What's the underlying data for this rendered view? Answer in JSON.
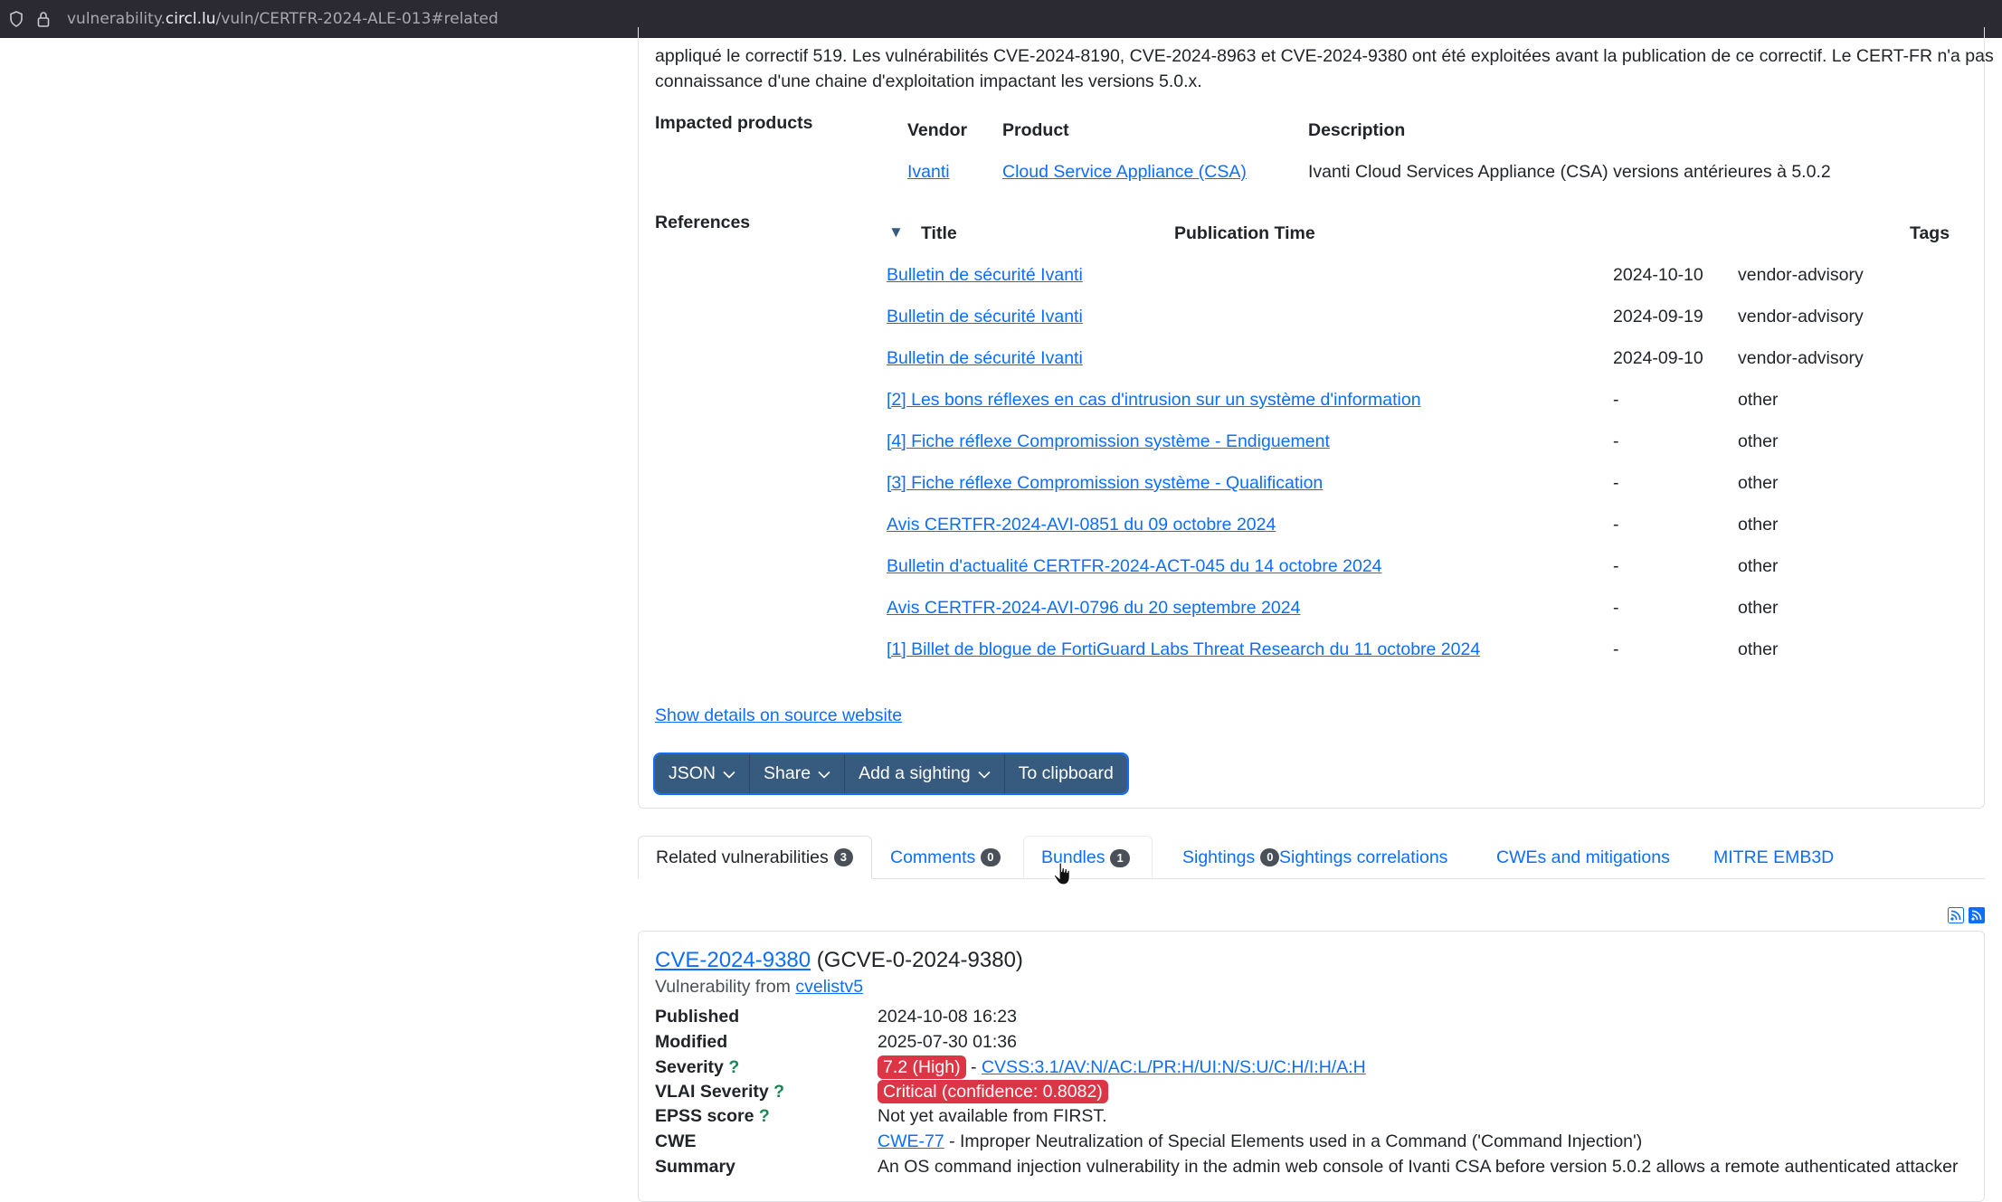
{
  "browser": {
    "url_prefix": "vulnerability.",
    "url_host": "circl.lu",
    "url_path": "/vuln/CERTFR-2024-ALE-013#related"
  },
  "description": {
    "line1": "appliqué le correctif 519. Les vulnérabilités CVE-2024-8190, CVE-2024-8963 et CVE-2024-9380 ont été exploitées avant la publication de ce correctif. Le CERT-FR n'a pas",
    "line2": "connaissance d'une chaine d'exploitation impactant les versions 5.0.x."
  },
  "impacted": {
    "label": "Impacted products",
    "headers": {
      "vendor": "Vendor",
      "product": "Product",
      "description": "Description"
    },
    "row": {
      "vendor": "Ivanti",
      "product": "Cloud Service Appliance (CSA)",
      "description": "Ivanti Cloud Services Appliance (CSA) versions antérieures à 5.0.2"
    }
  },
  "references": {
    "label": "References",
    "sort_glyph": "▼",
    "headers": {
      "title": "Title",
      "pubtime": "Publication Time",
      "tags": "Tags"
    },
    "rows": [
      {
        "title": "Bulletin de sécurité Ivanti",
        "date": "2024-10-10",
        "tag": "vendor-advisory"
      },
      {
        "title": "Bulletin de sécurité Ivanti",
        "date": "2024-09-19",
        "tag": "vendor-advisory"
      },
      {
        "title": "Bulletin de sécurité Ivanti",
        "date": "2024-09-10",
        "tag": "vendor-advisory"
      },
      {
        "title": "[2] Les bons réflexes en cas d'intrusion sur un système d'information",
        "date": "-",
        "tag": "other"
      },
      {
        "title": "[4] Fiche réflexe Compromission système - Endiguement",
        "date": "-",
        "tag": "other"
      },
      {
        "title": "[3] Fiche réflexe Compromission système - Qualification",
        "date": "-",
        "tag": "other"
      },
      {
        "title": "Avis CERTFR-2024-AVI-0851 du 09 octobre 2024",
        "date": "-",
        "tag": "other"
      },
      {
        "title": "Bulletin d'actualité CERTFR-2024-ACT-045 du 14 octobre 2024",
        "date": "-",
        "tag": "other"
      },
      {
        "title": "Avis CERTFR-2024-AVI-0796 du 20 septembre 2024",
        "date": "-",
        "tag": "other"
      },
      {
        "title": "[1] Billet de blogue de FortiGuard Labs Threat Research du 11 octobre 2024",
        "date": "-",
        "tag": "other"
      }
    ]
  },
  "source_link": "Show details on source website",
  "actions": {
    "json": "JSON",
    "share": "Share",
    "add_sighting": "Add a sighting",
    "clipboard": "To clipboard"
  },
  "tabs": [
    {
      "label": "Related vulnerabilities",
      "count": "3"
    },
    {
      "label": "Comments",
      "count": "0"
    },
    {
      "label": "Bundles",
      "count": "1"
    },
    {
      "label": "Sightings",
      "count": "0"
    },
    {
      "label": "Sightings correlations",
      "count": ""
    },
    {
      "label": "CWEs and mitigations",
      "count": ""
    },
    {
      "label": "MITRE EMB3D",
      "count": ""
    }
  ],
  "vuln": {
    "id": "CVE-2024-9380",
    "gcve": "(GCVE-0-2024-9380)",
    "from_label": "Vulnerability from",
    "from_source": "cvelistv5",
    "fields": {
      "published_label": "Published",
      "published": "2024-10-08 16:23",
      "modified_label": "Modified",
      "modified": "2025-07-30 01:36",
      "severity_label": "Severity",
      "severity_score": "7.2 (High)",
      "severity_sep": " - ",
      "cvss_vector": "CVSS:3.1/AV:N/AC:L/PR:H/UI:N/S:U/C:H/I:H/A:H",
      "vlai_label": "VLAI Severity",
      "vlai_value": "Critical (confidence: 0.8082)",
      "epss_label": "EPSS score",
      "epss_value": "Not yet available from FIRST.",
      "cwe_label": "CWE",
      "cwe_id": "CWE-77",
      "cwe_desc": " - Improper Neutralization of Special Elements used in a Command ('Command Injection')",
      "summary_label": "Summary",
      "summary": "An OS command injection vulnerability in the admin web console of Ivanti CSA before version 5.0.2 allows a remote authenticated attacker",
      "help_glyph": "?"
    }
  },
  "colors": {
    "link": "#0d6efd",
    "button_bg": "#375a7f",
    "danger": "#dc3545",
    "badge": "#495057",
    "help": "#198754"
  },
  "icons": {
    "shield": "shield-icon",
    "lock": "lock-icon",
    "rss": "rss-icon",
    "cursor": "mouse-pointer-icon"
  }
}
